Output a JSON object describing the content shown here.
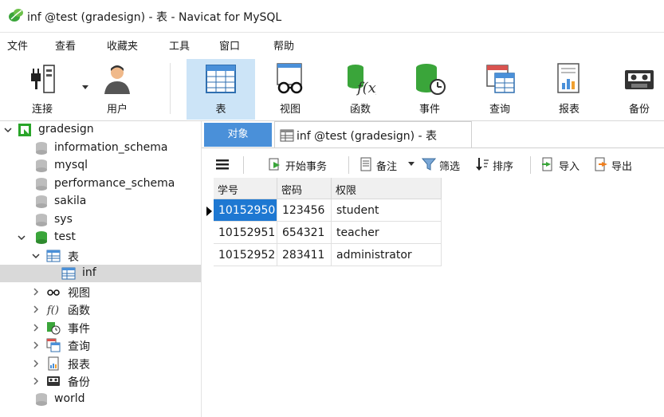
{
  "window": {
    "title": "inf @test (gradesign) - 表 - Navicat for MySQL"
  },
  "menu": [
    "文件",
    "查看",
    "收藏夹",
    "工具",
    "窗口",
    "帮助"
  ],
  "toolbar": [
    {
      "label": "连接",
      "icon": "plug-icon"
    },
    {
      "label": "用户",
      "icon": "user-icon"
    },
    {
      "label": "表",
      "icon": "table-icon"
    },
    {
      "label": "视图",
      "icon": "view-glasses-icon"
    },
    {
      "label": "函数",
      "icon": "function-icon"
    },
    {
      "label": "事件",
      "icon": "event-clock-icon"
    },
    {
      "label": "查询",
      "icon": "query-icon"
    },
    {
      "label": "报表",
      "icon": "report-icon"
    },
    {
      "label": "备份",
      "icon": "backup-tape-icon"
    }
  ],
  "sidebar": {
    "connection": "gradesign",
    "databases": [
      "information_schema",
      "mysql",
      "performance_schema",
      "sakila",
      "sys"
    ],
    "active_db": "test",
    "tables_node": "表",
    "table": "inf",
    "groups": [
      "视图",
      "函数",
      "事件",
      "查询",
      "报表",
      "备份"
    ],
    "last_db": "world"
  },
  "tabs": {
    "objects": "对象",
    "active": "inf @test (gradesign) - 表"
  },
  "objbar": {
    "begin_tx": "开始事务",
    "memo": "备注",
    "filter": "筛选",
    "sort": "排序",
    "import": "导入",
    "export": "导出"
  },
  "grid": {
    "columns": [
      "学号",
      "密码",
      "权限"
    ],
    "rows": [
      [
        "10152950",
        "123456",
        "student"
      ],
      [
        "10152951",
        "654321",
        "teacher"
      ],
      [
        "10152952",
        "283411",
        "administrator"
      ]
    ]
  },
  "colors": {
    "accent": "#4a90d9",
    "selection": "#1e78d2",
    "toolbar_active": "#cce4f7"
  }
}
